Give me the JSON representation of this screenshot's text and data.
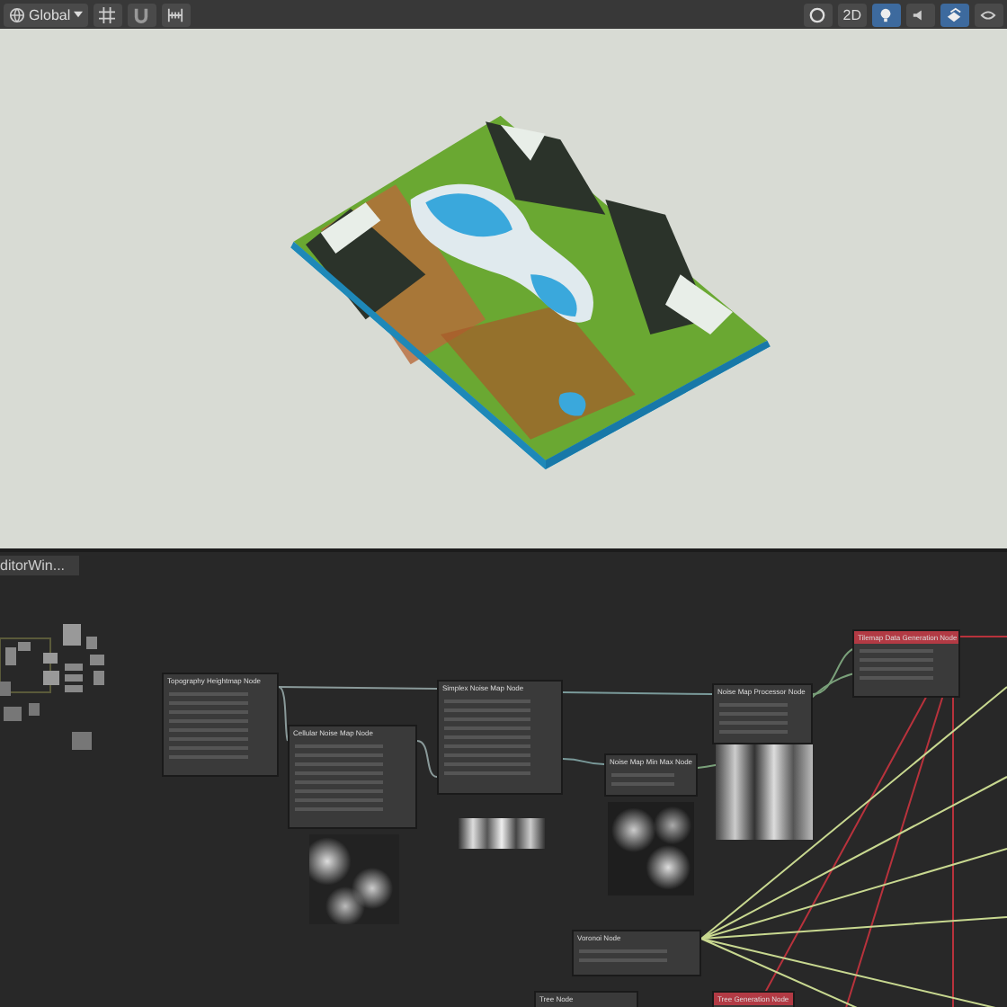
{
  "scene_toolbar": {
    "left": [
      {
        "kind": "pivot",
        "label": "Global"
      },
      {
        "kind": "grid"
      },
      {
        "kind": "snap"
      },
      {
        "kind": "increment"
      }
    ],
    "right": [
      {
        "kind": "gizmo",
        "selected": false
      },
      {
        "kind": "toggle2d",
        "label": "2D",
        "selected": false
      },
      {
        "kind": "lighting",
        "selected": true
      },
      {
        "kind": "audio",
        "selected": false
      },
      {
        "kind": "effects",
        "selected": true
      },
      {
        "kind": "more",
        "selected": false
      }
    ]
  },
  "graph": {
    "tab": {
      "label": "ditorWin..."
    },
    "nodes": [
      {
        "title": "Topography Heightmap Node",
        "color": "#3a3a3a",
        "kind": "plain"
      },
      {
        "title": "Cellular Noise Map Node",
        "color": "#3a3a3a",
        "kind": "cells"
      },
      {
        "title": "Simplex Noise Map Node",
        "color": "#3a3a3a",
        "kind": "strip"
      },
      {
        "title": "Noise Map Min Max Node",
        "color": "#3a3a3a",
        "kind": "blobs"
      },
      {
        "title": "Noise Map Processor Node",
        "color": "#3a3a3a",
        "kind": "tall"
      },
      {
        "title": "Tilemap Data Generation Node",
        "color": "#b23a44",
        "kind": "plain"
      },
      {
        "title": "Voronoi Node",
        "color": "#3a3a3a",
        "kind": "plain"
      },
      {
        "title": "Tree Node",
        "color": "#3a3a3a",
        "kind": "plain"
      },
      {
        "title": "Tree Generation Node",
        "color": "#b23a44",
        "kind": "plain"
      }
    ]
  }
}
